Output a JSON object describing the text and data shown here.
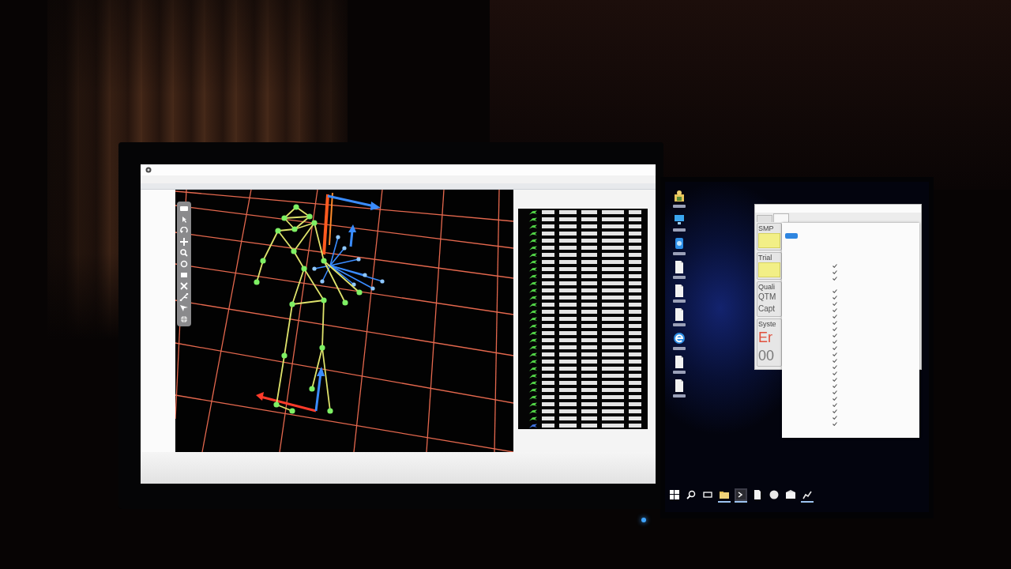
{
  "left_monitor": {
    "trajectory_table": {
      "rows": [
        {
          "color": "#52d447"
        },
        {
          "color": "#52d447"
        },
        {
          "color": "#52d447"
        },
        {
          "color": "#52d447"
        },
        {
          "color": "#52d447"
        },
        {
          "color": "#52d447"
        },
        {
          "color": "#52d447"
        },
        {
          "color": "#52d447"
        },
        {
          "color": "#52d447"
        },
        {
          "color": "#52d447"
        },
        {
          "color": "#52d447"
        },
        {
          "color": "#52d447"
        },
        {
          "color": "#52d447"
        },
        {
          "color": "#52d447"
        },
        {
          "color": "#52d447"
        },
        {
          "color": "#52d447"
        },
        {
          "color": "#52d447"
        },
        {
          "color": "#52d447"
        },
        {
          "color": "#52d447"
        },
        {
          "color": "#52d447"
        },
        {
          "color": "#52d447"
        },
        {
          "color": "#52d447"
        },
        {
          "color": "#52d447"
        },
        {
          "color": "#52d447"
        },
        {
          "color": "#52d447"
        },
        {
          "color": "#52d447"
        },
        {
          "color": "#52d447"
        },
        {
          "color": "#52d447"
        },
        {
          "color": "#52d447"
        },
        {
          "color": "#52d447"
        },
        {
          "color": "#3f72e0"
        }
      ]
    }
  },
  "right_monitor": {
    "window": {
      "tabs": [
        {
          "selected": false
        },
        {
          "selected": true
        }
      ],
      "groups": [
        {
          "kind": "note",
          "title": "SMP"
        },
        {
          "kind": "note",
          "title": "Trial"
        },
        {
          "kind": "lines",
          "title": "Quali",
          "lines": [
            "QTM",
            "Capt"
          ]
        },
        {
          "kind": "status",
          "title": "Syste",
          "status": "Er",
          "counter": "00"
        }
      ]
    },
    "popup": {
      "rows": [
        {
          "checked": true
        },
        {
          "checked": true
        },
        {
          "checked": true
        },
        {
          "checked": false
        },
        {
          "checked": true
        },
        {
          "checked": true
        },
        {
          "checked": true
        },
        {
          "checked": true
        },
        {
          "checked": true
        },
        {
          "checked": true
        },
        {
          "checked": true
        },
        {
          "checked": true
        },
        {
          "checked": true
        },
        {
          "checked": true
        },
        {
          "checked": true
        },
        {
          "checked": true
        },
        {
          "checked": true
        },
        {
          "checked": true
        },
        {
          "checked": true
        },
        {
          "checked": true
        },
        {
          "checked": true
        },
        {
          "checked": true
        },
        {
          "checked": true
        },
        {
          "checked": true
        },
        {
          "checked": true
        },
        {
          "checked": true
        }
      ]
    },
    "taskbar": {
      "items": [
        {
          "selected": false,
          "running": false
        },
        {
          "selected": false,
          "running": false
        },
        {
          "selected": false,
          "running": false
        },
        {
          "selected": false,
          "running": true
        },
        {
          "selected": true,
          "running": true
        },
        {
          "selected": false,
          "running": false
        },
        {
          "selected": false,
          "running": false
        },
        {
          "selected": false,
          "running": false
        },
        {
          "selected": false,
          "running": true
        }
      ]
    }
  }
}
